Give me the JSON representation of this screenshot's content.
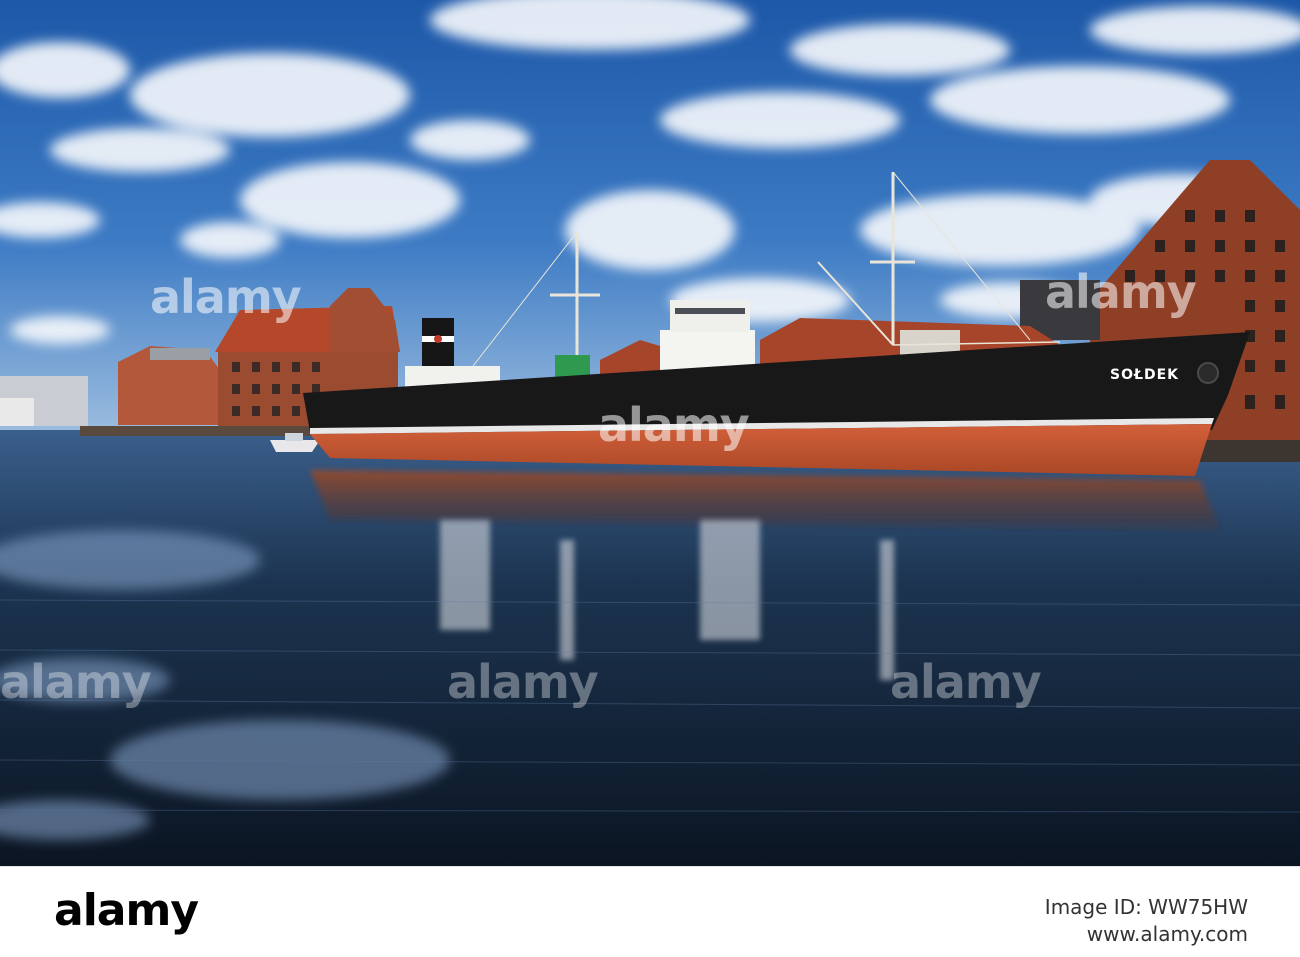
{
  "photo": {
    "description_colors": {
      "sky_top": "#1f5fb0",
      "sky_mid": "#3d7bc4",
      "cloud": "#f2f5fa",
      "hull_red": "#c9562f",
      "hull_black": "#1a1a1a",
      "superstructure": "#f3f3f0",
      "brick": "#9b4a2c",
      "roof": "#b5482a",
      "water_dark": "#0f1d2c",
      "water_reflect": "#6e8fb8"
    },
    "ship_name": "SOŁDEK",
    "watermark": "alamy"
  },
  "bottom_bar": {
    "logo": "alamy",
    "image_id": "Image ID: WW75HW",
    "url": "www.alamy.com"
  }
}
